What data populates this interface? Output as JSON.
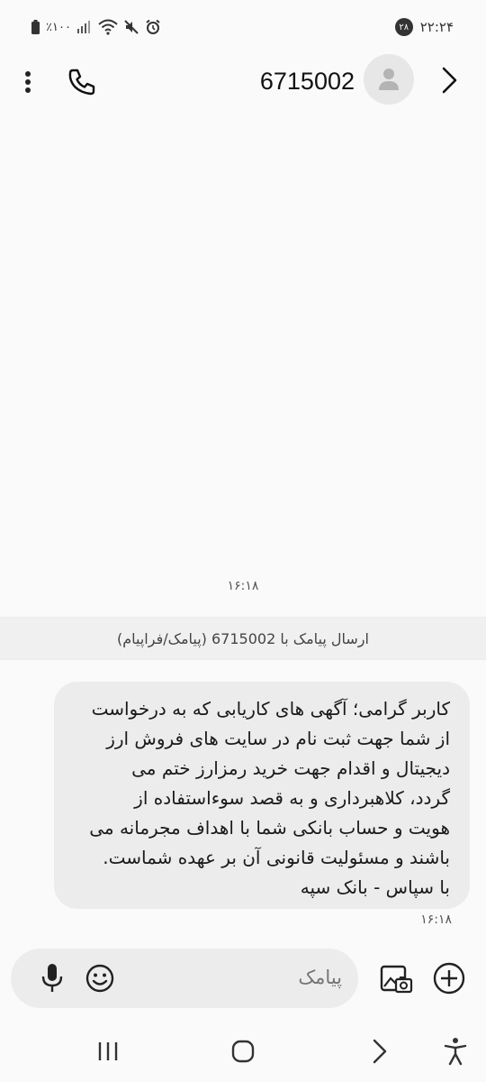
{
  "status_bar": {
    "battery_text": "٪۱۰۰",
    "clock": "۲۲:۲۴",
    "notification_count": "۲۸"
  },
  "header": {
    "contact_number": "6715002",
    "icons": [
      "more-vertical-icon",
      "phone-icon",
      "avatar-person-icon",
      "chevron-right-icon"
    ]
  },
  "conversation": {
    "date_label": "۱۶:۱۸",
    "send_info": "ارسال پیامک با 6715002 (پیامک/فراپیام)",
    "messages": [
      {
        "lines": [
          "کاربر گرامی؛ آگهی های کاریابی که به درخواست",
          "از شما جهت ثبت نام در سایت های فروش ارز",
          "دیجیتال و اقدام جهت خرید رمزارز ختم می",
          "گردد، کلاهبرداری و به قصد سوءاستفاده از",
          "هویت و حساب بانکی شما با اهداف مجرمانه می",
          "باشند و مسئولیت قانونی آن بر عهده شماست.",
          "با سپاس - بانک سپه"
        ],
        "time": "۱۶:۱۸"
      }
    ]
  },
  "composer": {
    "placeholder": "پیامک",
    "icons": [
      "microphone-icon",
      "emoji-icon",
      "gallery-icon",
      "add-icon"
    ]
  },
  "colors": {
    "background": "#fafafa",
    "bubble": "#ececec",
    "band": "#f0f0f0"
  }
}
